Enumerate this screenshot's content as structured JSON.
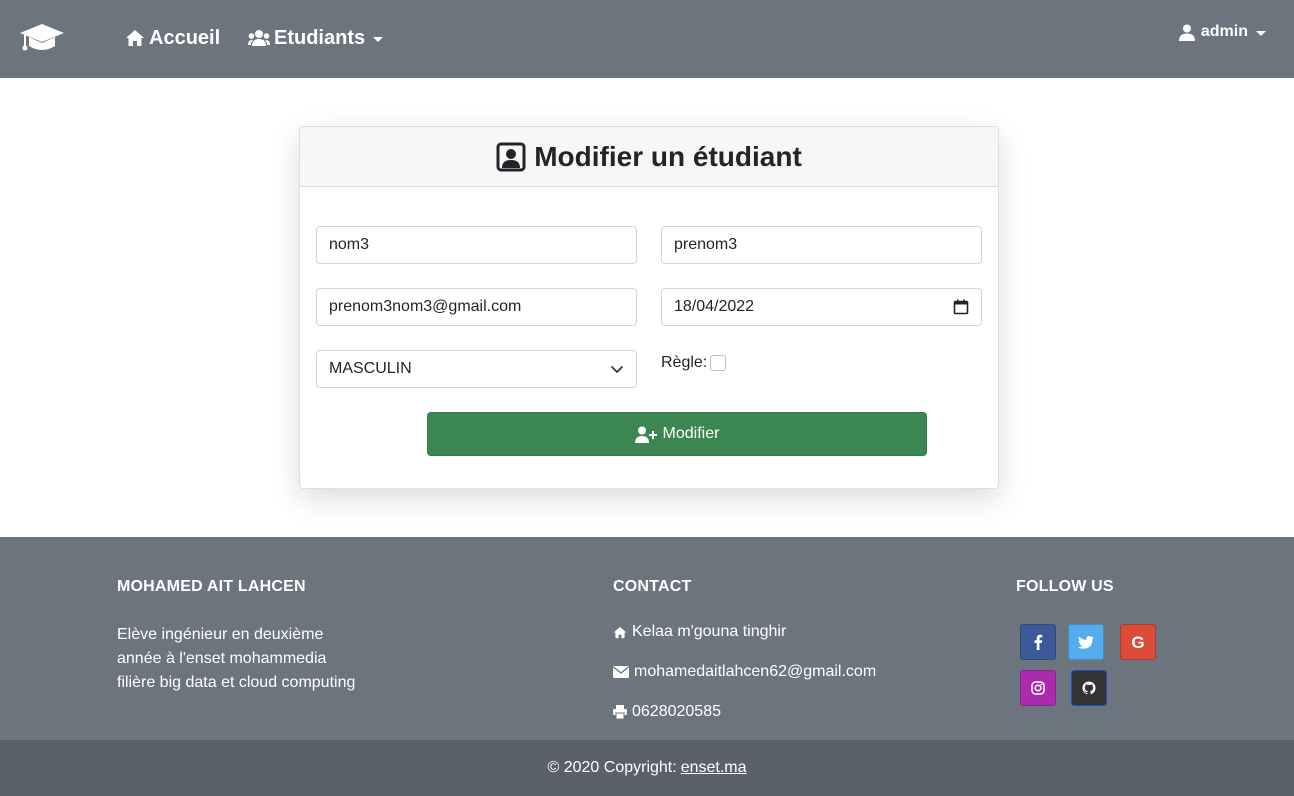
{
  "navbar": {
    "brand_icon": "graduation-cap-icon",
    "home_label": "Accueil",
    "students_label": "Etudiants",
    "user_label": "admin"
  },
  "form": {
    "title": "Modifier un étudiant",
    "nom_value": "nom3",
    "prenom_value": "prenom3",
    "email_value": "prenom3nom3@gmail.com",
    "date_value": "18/04/2022",
    "genre_value": "MASCULIN",
    "regle_label": "Règle:",
    "regle_checked": false,
    "submit_label": "Modifier",
    "submit_color": "#3b8651"
  },
  "footer": {
    "about_heading": "MOHAMED AIT LAHCEN",
    "about_lines": [
      "Elève ingénieur en deuxième",
      "année à l'enset mohammedia",
      "filière big data et cloud computing"
    ],
    "contact_heading": "CONTACT",
    "address": "Kelaa m'gouna tinghir",
    "email": "mohamedaitlahcen62@gmail.com",
    "phone": "0628020585",
    "follow_heading": "FOLLOW US",
    "social": [
      {
        "name": "facebook-icon",
        "color": "#3b5998"
      },
      {
        "name": "twitter-icon",
        "color": "#55acee"
      },
      {
        "name": "google-icon",
        "color": "#dd4b39"
      },
      {
        "name": "instagram-icon",
        "color": "#ac2bac"
      },
      {
        "name": "github-icon",
        "color": "#333333"
      }
    ],
    "copyright_prefix": "© 2020 Copyright:",
    "copyright_link": "enset.ma"
  },
  "colors": {
    "navbar_bg": "#6c757d",
    "footer_bg": "#6c757d",
    "bottom_bar_bg": "#5a6168"
  }
}
